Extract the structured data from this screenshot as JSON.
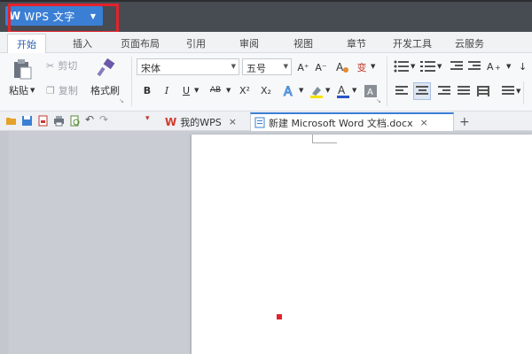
{
  "app": {
    "logo": "W",
    "title": "WPS 文字"
  },
  "menu_tabs": [
    "开始",
    "插入",
    "页面布局",
    "引用",
    "审阅",
    "视图",
    "章节",
    "开发工具",
    "云服务"
  ],
  "ribbon": {
    "paste": "粘贴",
    "cut": "剪切",
    "copy": "复制",
    "format_painter": "格式刷",
    "font_name": "宋体",
    "font_size": "五号",
    "bold": "B",
    "italic": "I",
    "underline": "U",
    "strike": "AB",
    "superscript": "X²",
    "subscript": "X₂",
    "grow_font": "A⁺",
    "shrink_font": "A⁻",
    "pinyin": "变"
  },
  "doc_tabs": [
    {
      "label": "我的WPS",
      "close": "×"
    },
    {
      "label": "新建 Microsoft Word 文档.docx",
      "close": "×"
    }
  ],
  "new_tab": "+",
  "colors": {
    "accent": "#3a7fd4",
    "highlight": "#e3232c",
    "wps_red": "#d23b2e"
  }
}
